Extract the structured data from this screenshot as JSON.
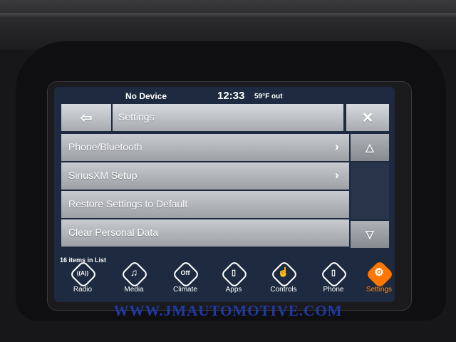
{
  "status": {
    "device": "No Device",
    "time": "12:33",
    "temperature": "59°F out"
  },
  "header": {
    "back_icon": "arrow-left-icon",
    "title": "Settings",
    "close_icon": "close-icon"
  },
  "menu": {
    "items": [
      {
        "label": "Phone/Bluetooth",
        "has_chevron": true
      },
      {
        "label": "SiriusXM Setup",
        "has_chevron": true
      },
      {
        "label": "Restore Settings to Default",
        "has_chevron": false
      },
      {
        "label": "Clear Personal Data",
        "has_chevron": false
      }
    ],
    "count_label": "16 items in List"
  },
  "dock": {
    "items": [
      {
        "label": "Radio",
        "icon": "radio-icon",
        "glyph": "((A))",
        "active": false
      },
      {
        "label": "Media",
        "icon": "music-note-icon",
        "glyph": "♫",
        "active": false
      },
      {
        "label": "Climate",
        "icon": "climate-icon",
        "glyph": "Off",
        "active": false
      },
      {
        "label": "Apps",
        "icon": "apps-icon",
        "glyph": "▯",
        "active": false
      },
      {
        "label": "Controls",
        "icon": "controls-icon",
        "glyph": "☝",
        "active": false
      },
      {
        "label": "Phone",
        "icon": "phone-icon",
        "glyph": "▯",
        "active": false
      },
      {
        "label": "Settings",
        "icon": "gear-icon",
        "glyph": "⚙",
        "active": true
      }
    ]
  },
  "watermark": "WWW.JMAUTOMOTIVE.COM",
  "colors": {
    "accent": "#ff7700",
    "watermark": "#1f3aa8"
  }
}
